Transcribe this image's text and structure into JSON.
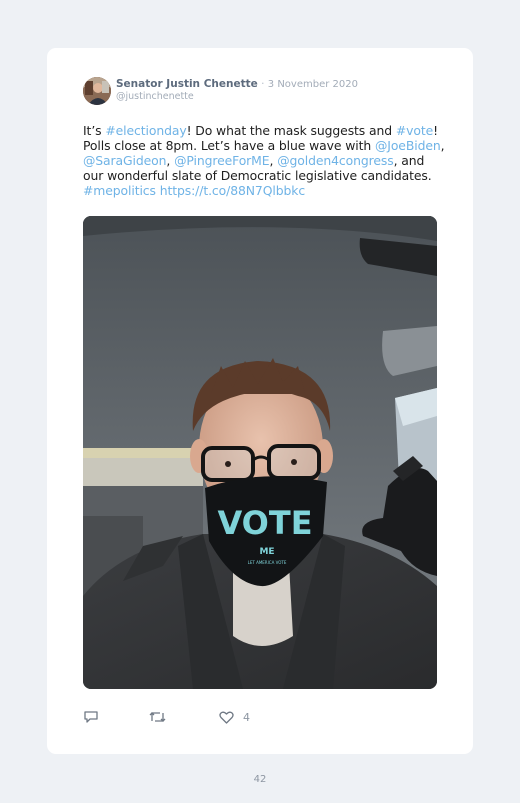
{
  "tweet": {
    "author_name": "Senator Justin Chenette",
    "separator": "·",
    "date": "3 November 2020",
    "handle": "@justinchenette",
    "text": {
      "p1": "It’s ",
      "l1": "#electionday",
      "p2": "! Do what the mask suggests and ",
      "l2": "#vote",
      "p3": "! Polls close at 8pm. Let’s have a blue wave with ",
      "l3": "@JoeBiden",
      "p4": ", ",
      "l4": "@SaraGideon",
      "p5": ", ",
      "l5": "@PingreeForME",
      "p6": ", ",
      "l6": "@golden4congress",
      "p7": ", and our wonderful slate of Democratic legislative candidates. ",
      "l7": "#mepolitics",
      "p8": " ",
      "l8": "https://t.co/88N7Qlbbkc"
    },
    "photo": {
      "mask_text": "VOTE",
      "mask_subtext": "ME",
      "mask_fineprint": "LET AMERICA VOTE"
    },
    "actions": {
      "reply_icon": "reply-icon",
      "retweet_icon": "retweet-icon",
      "like_icon": "heart-icon",
      "like_count": "4"
    }
  },
  "page": {
    "number": "42"
  },
  "colors": {
    "link": "#6fb3e6",
    "name": "#5d6b7d",
    "meta": "#a3acb8",
    "background": "#eef1f5",
    "mask_teal": "#7fd3d9"
  }
}
